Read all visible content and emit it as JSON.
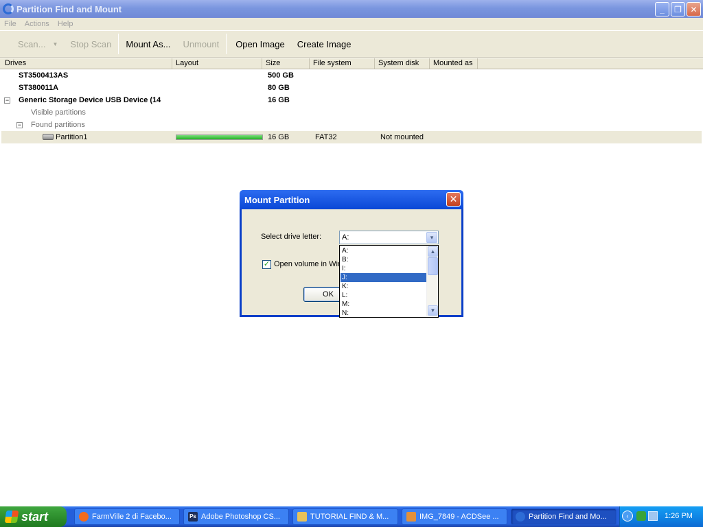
{
  "window": {
    "title": "Partition Find and Mount"
  },
  "menu": [
    "File",
    "Actions",
    "Help"
  ],
  "toolbar": {
    "scan": "Scan...",
    "stop_scan": "Stop Scan",
    "mount_as": "Mount As...",
    "unmount": "Unmount",
    "open_image": "Open Image",
    "create_image": "Create Image"
  },
  "columns": [
    "Drives",
    "Layout",
    "Size",
    "File system",
    "System disk",
    "Mounted as"
  ],
  "drives": [
    {
      "name": "ST3500413AS",
      "size": "500 GB"
    },
    {
      "name": "ST380011A",
      "size": "80 GB"
    },
    {
      "name": "Generic Storage Device USB Device  (14",
      "size": "16 GB",
      "expander": "−"
    }
  ],
  "groups": {
    "visible": "Visible partitions",
    "found": "Found partitions",
    "expander": "−"
  },
  "partition": {
    "name": "Partition1",
    "size": "16 GB",
    "filesystem": "FAT32",
    "status": "Not mounted",
    "layout_fill": 1.0
  },
  "dialog": {
    "title": "Mount Partition",
    "select_label": "Select drive letter:",
    "selected_letter": "A:",
    "checkbox_label": "Open volume in Wind",
    "checkbox_checked": "✓",
    "ok": "OK",
    "close": "✕",
    "dropdown_arrow": "▾",
    "options": [
      "A:",
      "B:",
      "I:",
      "J:",
      "K:",
      "L:",
      "M:",
      "N:"
    ],
    "highlighted_option": "J:",
    "scroll_up": "▲",
    "scroll_down": "▼"
  },
  "taskbar": {
    "start": "start",
    "tasks": [
      {
        "label": "FarmVille 2 di Facebo...",
        "icon_color": "#f26b1d"
      },
      {
        "label": "Adobe Photoshop CS...",
        "icon_color": "#1e2f59",
        "icon_text": "Ps"
      },
      {
        "label": "TUTORIAL FIND & M...",
        "icon_color": "#e8c25a"
      },
      {
        "label": "IMG_7849 - ACDSee ...",
        "icon_color": "#e3903a"
      },
      {
        "label": "Partition Find and Mo...",
        "icon_color": "#2d6cd6"
      }
    ],
    "tray_chevron": "‹",
    "clock": "1:26 PM"
  }
}
